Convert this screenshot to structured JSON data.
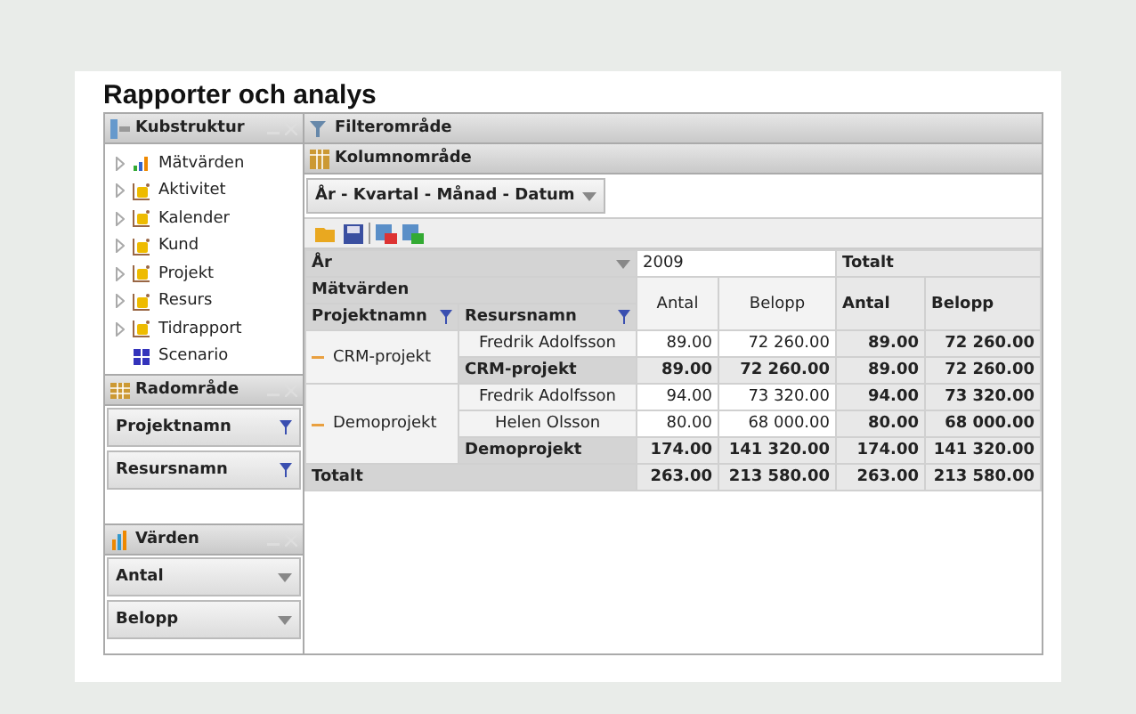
{
  "title": "Rapporter och analys",
  "cube_panel": {
    "title": "Kubstruktur",
    "items": [
      {
        "label": "Mätvärden",
        "kind": "measure"
      },
      {
        "label": "Aktivitet",
        "kind": "dimension"
      },
      {
        "label": "Kalender",
        "kind": "dimension"
      },
      {
        "label": "Kund",
        "kind": "dimension"
      },
      {
        "label": "Projekt",
        "kind": "dimension"
      },
      {
        "label": "Resurs",
        "kind": "dimension"
      },
      {
        "label": "Tidrapport",
        "kind": "dimension"
      },
      {
        "label": "Scenario",
        "kind": "set"
      }
    ]
  },
  "row_panel": {
    "title": "Radområde",
    "fields": [
      "Projektnamn",
      "Resursnamn"
    ]
  },
  "values_panel": {
    "title": "Värden",
    "fields": [
      "Antal",
      "Belopp"
    ]
  },
  "filter_area": {
    "title": "Filterområde"
  },
  "column_area": {
    "title": "Kolumnområde",
    "field": "År - Kvartal - Månad - Datum"
  },
  "pivot": {
    "year_header": "År",
    "year": "2009",
    "total_header": "Totalt",
    "measures_label": "Mätvärden",
    "row_headers": [
      "Projektnamn",
      "Resursnamn"
    ],
    "measures": [
      "Antal",
      "Belopp"
    ],
    "total_measures": [
      "Antal",
      "Belopp"
    ],
    "groups": [
      {
        "name": "CRM-projekt",
        "expanded": true,
        "rows": [
          {
            "resource": "Fredrik Adolfsson",
            "values": [
              "89.00",
              "72 260.00",
              "89.00",
              "72 260.00"
            ]
          }
        ],
        "subtotal": {
          "label": "CRM-projekt",
          "values": [
            "89.00",
            "72 260.00",
            "89.00",
            "72 260.00"
          ]
        }
      },
      {
        "name": "Demoprojekt",
        "expanded": true,
        "rows": [
          {
            "resource": "Fredrik Adolfsson",
            "values": [
              "94.00",
              "73 320.00",
              "94.00",
              "73 320.00"
            ]
          },
          {
            "resource": "Helen Olsson",
            "values": [
              "80.00",
              "68 000.00",
              "80.00",
              "68 000.00"
            ]
          }
        ],
        "subtotal": {
          "label": "Demoprojekt",
          "values": [
            "174.00",
            "141 320.00",
            "174.00",
            "141 320.00"
          ]
        }
      }
    ],
    "grand_total": {
      "label": "Totalt",
      "values": [
        "263.00",
        "213 580.00",
        "263.00",
        "213 580.00"
      ]
    }
  }
}
